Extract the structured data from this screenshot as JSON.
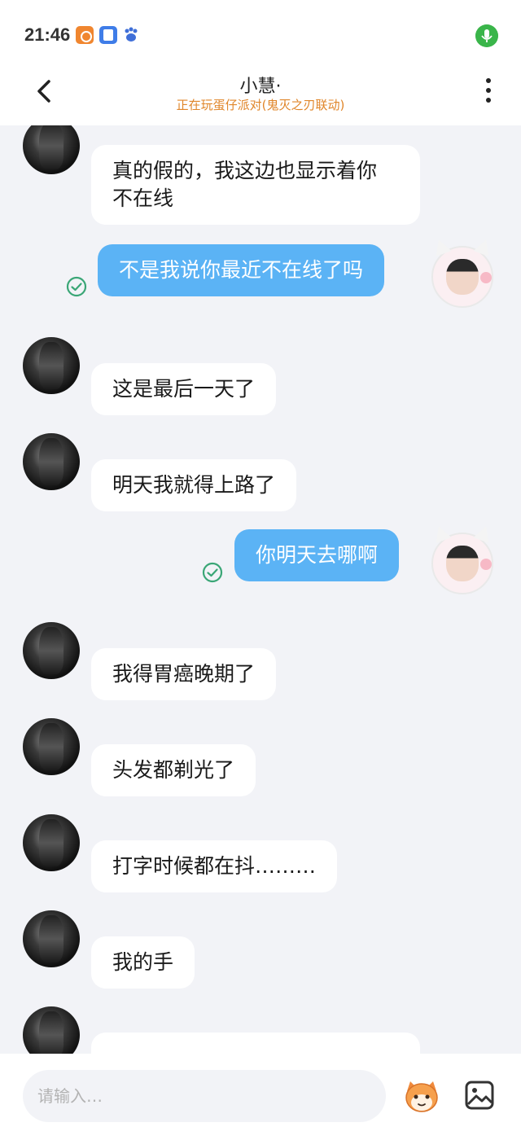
{
  "status_bar": {
    "time": "21:46",
    "icons": [
      "app-notification-orange-icon",
      "app-notification-blue-icon",
      "baidu-paw-icon",
      "microphone-icon"
    ],
    "mic_color": "#3ab54a"
  },
  "header": {
    "title": "小慧·",
    "subtitle": "正在玩蛋仔派对(鬼灭之刃联动)",
    "subtitle_color": "#e0862a",
    "back_icon": "chevron-left-icon",
    "more_icon": "more-vertical-icon"
  },
  "messages": [
    {
      "from": "them",
      "lines": [
        "真的假的，我这边也显示着你",
        "不在线"
      ]
    },
    {
      "from": "me",
      "text": "不是我说你最近不在线了吗",
      "read": true
    },
    {
      "from": "them",
      "text": "这是最后一天了"
    },
    {
      "from": "them",
      "text": "明天我就得上路了"
    },
    {
      "from": "me",
      "text": "你明天去哪啊",
      "read": true
    },
    {
      "from": "them",
      "text": "我得胃癌晚期了"
    },
    {
      "from": "them",
      "text": "头发都剃光了"
    },
    {
      "from": "them",
      "text": "打字时候都在抖………"
    },
    {
      "from": "them",
      "text": "我的手"
    }
  ],
  "input": {
    "placeholder": "请输入…",
    "sticker_icon": "sticker-face-icon",
    "image_icon": "image-icon"
  },
  "colors": {
    "outgoing_bubble": "#5bb3f5",
    "incoming_bubble": "#ffffff",
    "background": "#f2f3f7",
    "read_check": "#3aa676"
  }
}
